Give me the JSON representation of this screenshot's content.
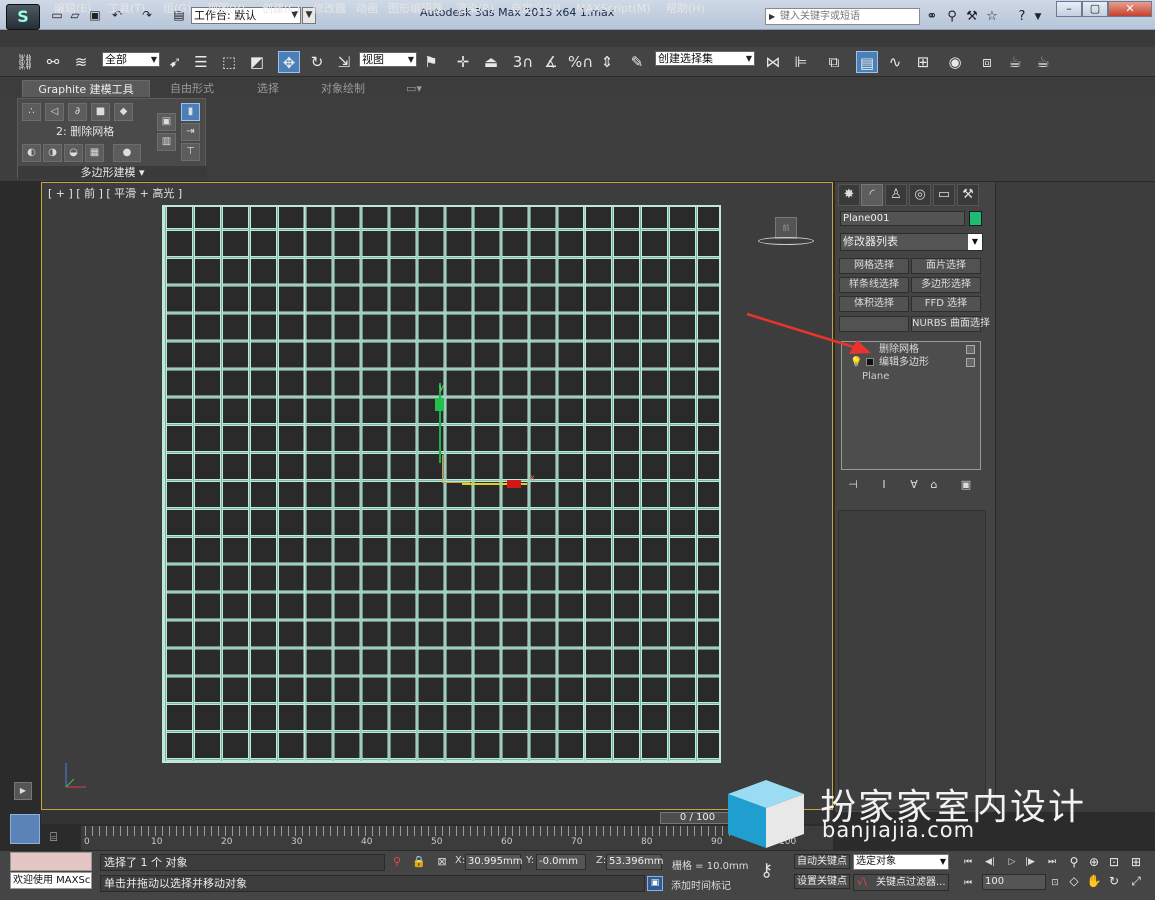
{
  "titlebar": {
    "workspace": "工作台: 默认",
    "window_title": "Autodesk 3ds Max  2013 x64       1.max",
    "search_placeholder": "键入关键字或短语"
  },
  "menu": [
    "编辑(E)",
    "工具(T)",
    "组(G)",
    "视图(V)",
    "创建(C)",
    "修改器",
    "动画",
    "图形编辑器",
    "渲染(R)",
    "自定义(U)",
    "MAXScript(M)",
    "帮助(H)"
  ],
  "toolbar": {
    "selection_filter": "全部",
    "ref_coord": "视图",
    "named_selection": "创建选择集",
    "snap3": "3",
    "percent": "%"
  },
  "ribbon": {
    "tabs": [
      "Graphite 建模工具",
      "自由形式",
      "选择",
      "对象绘制"
    ],
    "delete_mesh_label": "2: 删除网格",
    "group_label": "多边形建模 ▾"
  },
  "viewport": {
    "label": "[ + ] [ 前 ] [ 平滑 + 高光 ]",
    "axis_y": "y",
    "axis_x": "x",
    "viewcube_label": "前"
  },
  "command_panel": {
    "object_name": "Plane001",
    "object_color": "#1dbb74",
    "modifier_list": "修改器列表",
    "modifier_buttons": [
      "网格选择",
      "面片选择",
      "样条线选择",
      "多边形选择",
      "体积选择",
      "FFD 选择",
      "",
      "NURBS 曲面选择"
    ],
    "stack": [
      "删除网格",
      "编辑多边形",
      "Plane"
    ]
  },
  "timeline": {
    "slider": "0 / 100",
    "ticks": [
      "0",
      "10",
      "20",
      "30",
      "40",
      "50",
      "60",
      "70",
      "80",
      "90",
      "100"
    ]
  },
  "statusbar": {
    "welcome": "欢迎使用 MAXSc",
    "selection_status": "选择了 1 个 对象",
    "prompt": "单击并拖动以选择并移动对象",
    "x_label": "X:",
    "x_value": "30.995mm",
    "y_label": "Y:",
    "y_value": "-0.0mm",
    "z_label": "Z:",
    "z_value": "53.396mm",
    "grid": "栅格 = 10.0mm",
    "add_time_tag": "添加时间标记",
    "auto_key": "自动关键点",
    "set_key": "设置关键点",
    "selected_object": "选定对象",
    "key_filter": "关键点过滤器...",
    "frame": "100"
  },
  "watermark": {
    "text": "扮家家室内设计",
    "url": "banjiajia.com"
  },
  "colors": {
    "accent": "#4b7fb8",
    "viewport_border": "#c8a43a",
    "mesh": "#bfe8d8",
    "arrow": "#e8342c"
  }
}
